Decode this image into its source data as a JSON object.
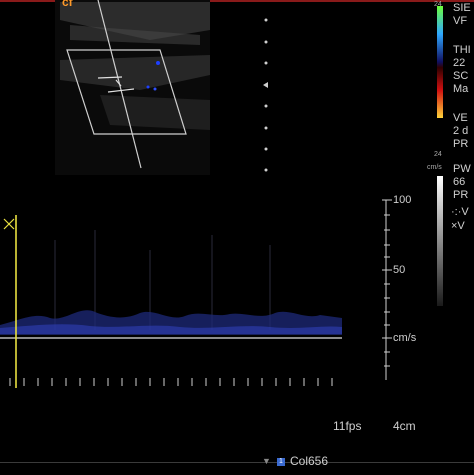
{
  "header": {
    "accent_line_color": "#8a1a1a",
    "orange_label": "cf"
  },
  "side_panel": {
    "line1": "SIE",
    "line2": "VF",
    "line3": "THI",
    "line4": "22",
    "line5": "SC",
    "line6": "Ma",
    "line7": "VE",
    "line8": "2 d",
    "line9": "PR",
    "line10": "PW",
    "line11": "66",
    "line12": "PR",
    "line13": "·:·V",
    "line14": "×V",
    "color_scale_top": "24",
    "color_scale_bottom": "24",
    "cm_s": "cm/s"
  },
  "spectrum": {
    "scale_labels": [
      "100",
      "50",
      "cm/s"
    ],
    "baseline_unit": "cm/s"
  },
  "status": {
    "frame_rate": "11fps",
    "depth": "4cm",
    "preset": "Col656"
  }
}
